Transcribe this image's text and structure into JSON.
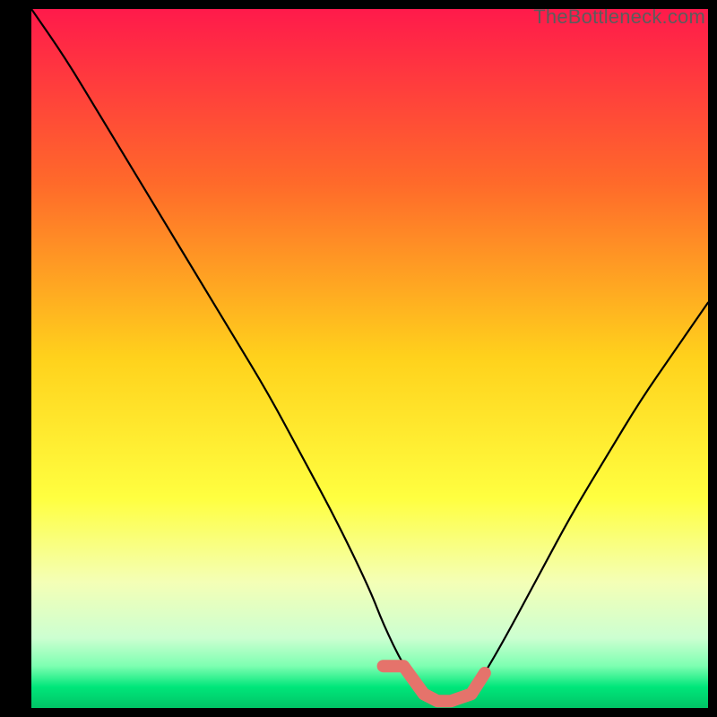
{
  "watermark": "TheBottleneck.com",
  "chart_data": {
    "type": "line",
    "title": "",
    "xlabel": "",
    "ylabel": "",
    "xlim": [
      0,
      100
    ],
    "ylim": [
      0,
      100
    ],
    "x": [
      0,
      5,
      10,
      15,
      20,
      25,
      30,
      35,
      40,
      45,
      50,
      52,
      55,
      58,
      60,
      62,
      65,
      67,
      70,
      75,
      80,
      85,
      90,
      95,
      100
    ],
    "values": [
      100,
      93,
      85,
      77,
      69,
      61,
      53,
      45,
      36,
      27,
      17,
      12,
      6,
      2,
      1,
      1,
      2,
      5,
      10,
      19,
      28,
      36,
      44,
      51,
      58
    ],
    "highlight_band": {
      "x_start": 52,
      "x_end": 67,
      "y_max": 6
    },
    "gradient_stops": [
      {
        "offset": 0.0,
        "color": "#ff1a4b"
      },
      {
        "offset": 0.25,
        "color": "#ff6a2a"
      },
      {
        "offset": 0.5,
        "color": "#ffd21c"
      },
      {
        "offset": 0.7,
        "color": "#ffff40"
      },
      {
        "offset": 0.82,
        "color": "#f4ffb6"
      },
      {
        "offset": 0.9,
        "color": "#ccffd1"
      },
      {
        "offset": 0.94,
        "color": "#7dffb1"
      },
      {
        "offset": 0.97,
        "color": "#00e67a"
      },
      {
        "offset": 1.0,
        "color": "#00c466"
      }
    ],
    "background": "#000000",
    "line_color": "#000000",
    "highlight_color": "#e5736b"
  }
}
